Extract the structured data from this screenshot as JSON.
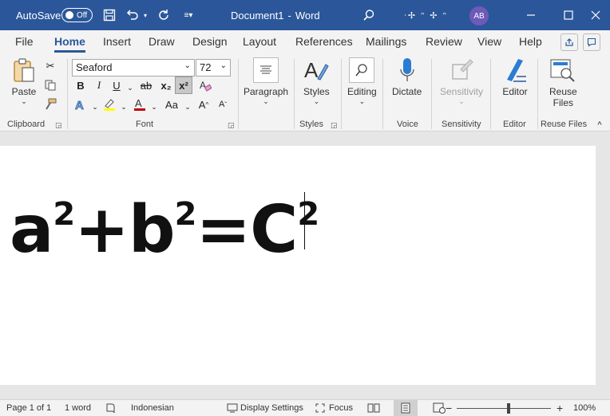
{
  "titlebar": {
    "autosave_label": "AutoSave",
    "autosave_state": "Off",
    "document_title": "Document1",
    "separator": "-",
    "app_name": "Word",
    "user_initials": "AB",
    "user_name_obscured": "ᐧ✢ ᵔ ✢ ᵔ"
  },
  "tabs": [
    "File",
    "Home",
    "Insert",
    "Draw",
    "Design",
    "Layout",
    "References",
    "Mailings",
    "Review",
    "View",
    "Help"
  ],
  "ribbon": {
    "clipboard": {
      "paste_label": "Paste",
      "group_label": "Clipboard"
    },
    "font": {
      "font_name": "Seaford",
      "font_size": "72",
      "group_label": "Font",
      "bold": "B",
      "italic": "I",
      "underline": "U",
      "strike": "ab",
      "subscript": "x₂",
      "superscript": "x²",
      "change_case": "Aa",
      "grow": "A",
      "shrink": "A"
    },
    "paragraph": {
      "label": "Paragraph"
    },
    "styles": {
      "label": "Styles",
      "group_label": "Styles"
    },
    "editing": {
      "label": "Editing"
    },
    "voice": {
      "label": "Dictate",
      "group_label": "Voice"
    },
    "sensitivity": {
      "label": "Sensitivity",
      "group_label": "Sensitivity"
    },
    "editor": {
      "label": "Editor",
      "group_label": "Editor"
    },
    "reuse": {
      "label_line1": "Reuse",
      "label_line2": "Files",
      "group_label": "Reuse Files"
    }
  },
  "document": {
    "eq_a": "a",
    "eq_exp1": "2",
    "eq_plus": "+",
    "eq_b": "b",
    "eq_exp2": "2",
    "eq_equals": "=",
    "eq_c": "C",
    "eq_exp3": "2"
  },
  "statusbar": {
    "page": "Page 1 of 1",
    "words": "1 word",
    "language": "Indonesian",
    "display_settings": "Display Settings",
    "focus": "Focus",
    "zoom_minus": "−",
    "zoom_plus": "+",
    "zoom_level": "100%",
    "zoom_fraction": 0.55
  },
  "colors": {
    "accent": "#2b579a",
    "avatar": "#6e5ab8",
    "highlight": "#ffff00",
    "font_color": "#c00000"
  }
}
